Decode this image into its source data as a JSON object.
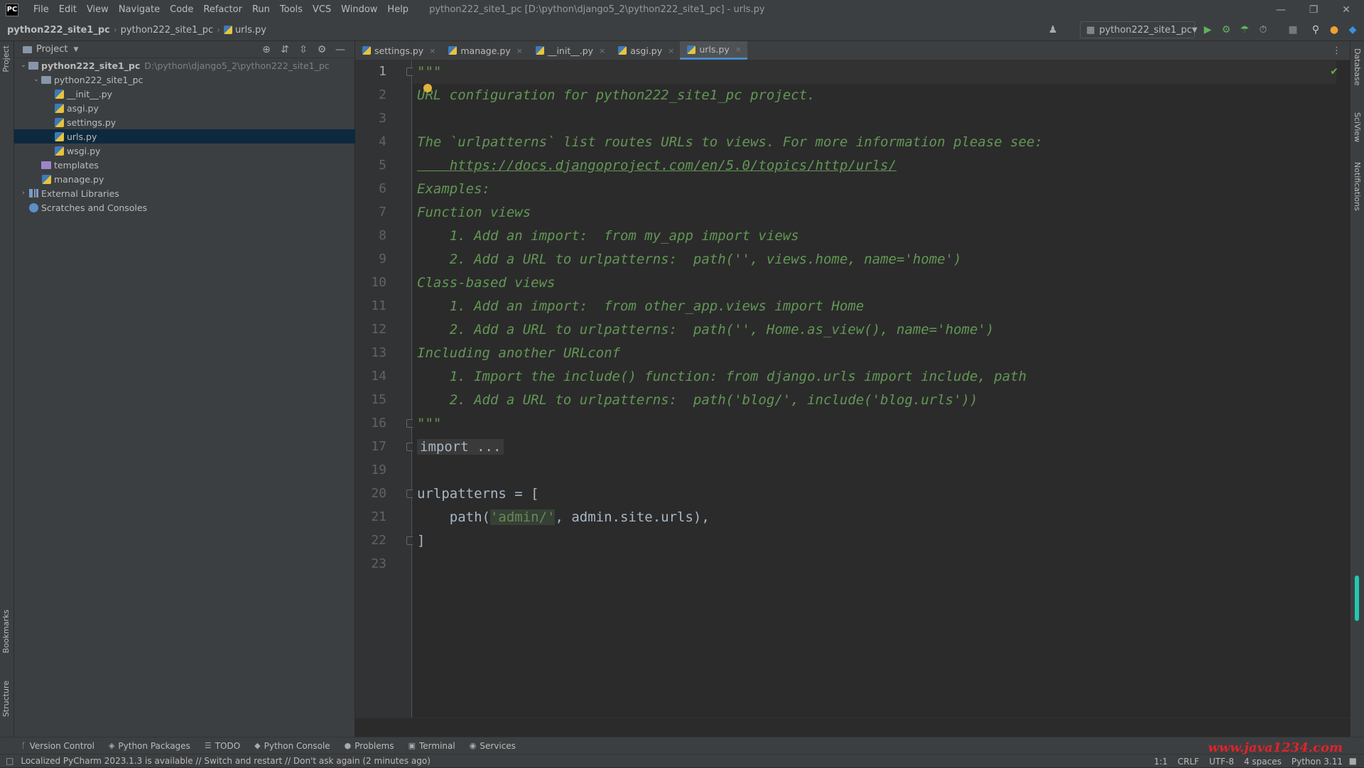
{
  "titlebar": {
    "logo": "PC",
    "menu": [
      "File",
      "Edit",
      "View",
      "Navigate",
      "Code",
      "Refactor",
      "Run",
      "Tools",
      "VCS",
      "Window",
      "Help"
    ],
    "window_title": "python222_site1_pc [D:\\python\\django5_2\\python222_site1_pc] - urls.py"
  },
  "navbar": {
    "crumbs": [
      "python222_site1_pc",
      "python222_site1_pc",
      "urls.py"
    ],
    "run_config": "python222_site1_pc"
  },
  "project": {
    "header": "Project",
    "tree": [
      {
        "label": "python222_site1_pc",
        "path": "D:\\python\\django5_2\\python222_site1_pc",
        "type": "folder",
        "level": 0,
        "expanded": true
      },
      {
        "label": "python222_site1_pc",
        "type": "folder",
        "level": 1,
        "expanded": true
      },
      {
        "label": "__init__.py",
        "type": "py",
        "level": 2
      },
      {
        "label": "asgi.py",
        "type": "py",
        "level": 2
      },
      {
        "label": "settings.py",
        "type": "py",
        "level": 2
      },
      {
        "label": "urls.py",
        "type": "py",
        "level": 2,
        "selected": true
      },
      {
        "label": "wsgi.py",
        "type": "py",
        "level": 2
      },
      {
        "label": "templates",
        "type": "folder-purple",
        "level": 1
      },
      {
        "label": "manage.py",
        "type": "py",
        "level": 1
      },
      {
        "label": "External Libraries",
        "type": "lib",
        "level": 0,
        "collapsed": true
      },
      {
        "label": "Scratches and Consoles",
        "type": "scratch",
        "level": 0
      }
    ]
  },
  "tabs": [
    {
      "label": "settings.py"
    },
    {
      "label": "manage.py"
    },
    {
      "label": "__init__.py"
    },
    {
      "label": "asgi.py"
    },
    {
      "label": "urls.py",
      "active": true
    }
  ],
  "editor": {
    "line_numbers": [
      "1",
      "2",
      "3",
      "4",
      "5",
      "6",
      "7",
      "8",
      "9",
      "10",
      "11",
      "12",
      "13",
      "14",
      "15",
      "16",
      "17",
      "19",
      "20",
      "21",
      "22",
      "23"
    ],
    "lines": [
      {
        "t": "doc",
        "text": "\"\"\""
      },
      {
        "t": "doc",
        "text": "URL configuration for python222_site1_pc project."
      },
      {
        "t": "doc",
        "text": ""
      },
      {
        "t": "doc",
        "text": "The `urlpatterns` list routes URLs to views. For more information please see:"
      },
      {
        "t": "link",
        "text": "    https://docs.djangoproject.com/en/5.0/topics/http/urls/"
      },
      {
        "t": "doc",
        "text": "Examples:"
      },
      {
        "t": "doc",
        "text": "Function views"
      },
      {
        "t": "doc",
        "text": "    1. Add an import:  from my_app import views"
      },
      {
        "t": "doc",
        "text": "    2. Add a URL to urlpatterns:  path('', views.home, name='home')"
      },
      {
        "t": "doc",
        "text": "Class-based views"
      },
      {
        "t": "doc",
        "text": "    1. Add an import:  from other_app.views import Home"
      },
      {
        "t": "doc",
        "text": "    2. Add a URL to urlpatterns:  path('', Home.as_view(), name='home')"
      },
      {
        "t": "doc",
        "text": "Including another URLconf"
      },
      {
        "t": "doc",
        "text": "    1. Import the include() function: from django.urls import include, path"
      },
      {
        "t": "doc",
        "text": "    2. Add a URL to urlpatterns:  path('blog/', include('blog.urls'))"
      },
      {
        "t": "doc",
        "text": "\"\"\""
      },
      {
        "t": "fold",
        "text": "import ..."
      },
      {
        "t": "plain",
        "text": ""
      },
      {
        "t": "plain",
        "text": "urlpatterns = ["
      },
      {
        "t": "path",
        "pre": "    path(",
        "str": "'admin/'",
        "post": ", admin.site.urls),"
      },
      {
        "t": "plain",
        "text": "]"
      },
      {
        "t": "plain",
        "text": ""
      }
    ]
  },
  "side_left": [
    "Project",
    "Bookmarks",
    "Structure"
  ],
  "side_right": [
    "Database",
    "SciView",
    "Notifications"
  ],
  "toolwindows": [
    {
      "label": "Version Control",
      "icon": "branch-icon"
    },
    {
      "label": "Python Packages",
      "icon": "package-icon"
    },
    {
      "label": "TODO",
      "icon": "list-icon"
    },
    {
      "label": "Python Console",
      "icon": "python-icon"
    },
    {
      "label": "Problems",
      "icon": "warning-icon"
    },
    {
      "label": "Terminal",
      "icon": "terminal-icon"
    },
    {
      "label": "Services",
      "icon": "services-icon"
    }
  ],
  "status": {
    "message": "Localized PyCharm 2023.1.3 is available // Switch and restart // Don't ask again (2 minutes ago)",
    "position": "1:1",
    "line_sep": "CRLF",
    "encoding": "UTF-8",
    "indent": "4 spaces",
    "interpreter": "Python 3.11"
  },
  "watermark": "www.java1234.com"
}
